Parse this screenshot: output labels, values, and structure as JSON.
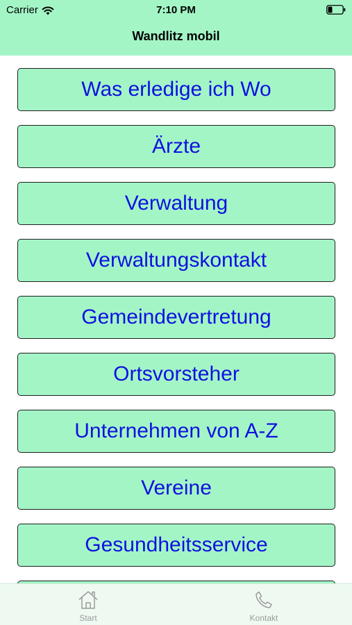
{
  "status_bar": {
    "carrier": "Carrier",
    "time": "7:10 PM",
    "icons": [
      "wifi-icon",
      "battery-icon"
    ]
  },
  "nav": {
    "title": "Wandlitz mobil"
  },
  "menu": {
    "items": [
      {
        "label": "Was erledige ich Wo"
      },
      {
        "label": "Ärzte"
      },
      {
        "label": "Verwaltung"
      },
      {
        "label": "Verwaltungskontakt"
      },
      {
        "label": "Gemeindevertretung"
      },
      {
        "label": "Ortsvorsteher"
      },
      {
        "label": "Unternehmen von A-Z"
      },
      {
        "label": "Vereine"
      },
      {
        "label": "Gesundheitsservice"
      }
    ]
  },
  "tab_bar": {
    "tabs": [
      {
        "label": "Start",
        "icon": "home-icon"
      },
      {
        "label": "Kontakt",
        "icon": "phone-icon"
      }
    ]
  },
  "colors": {
    "accent_background": "#a3f5c6",
    "item_text": "#1010e0",
    "tab_label": "#9a9a9a"
  }
}
